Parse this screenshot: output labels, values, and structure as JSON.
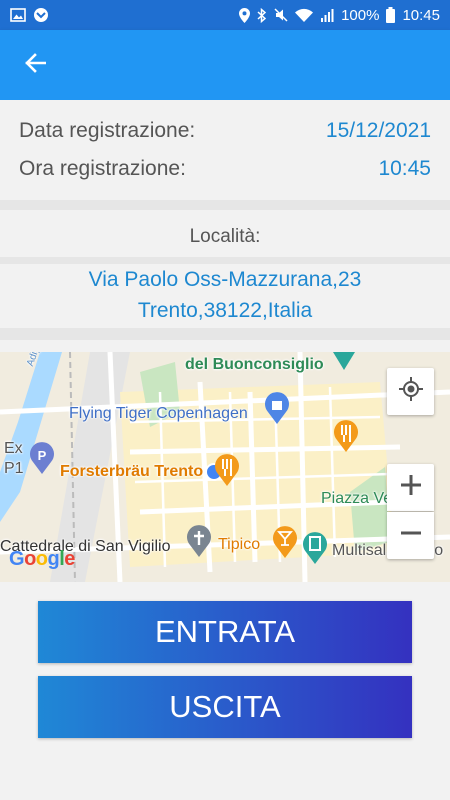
{
  "status_bar": {
    "battery_percent": "100%",
    "time": "10:45",
    "icons": [
      "image-icon",
      "app-icon",
      "location-icon",
      "bluetooth-icon",
      "mute-icon",
      "wifi-icon",
      "signal-icon",
      "battery-icon"
    ]
  },
  "app_bar": {
    "back_icon": "arrow-back-icon"
  },
  "registration": {
    "date_label": "Data registrazione:",
    "date_value": "15/12/2021",
    "time_label": "Ora registrazione:",
    "time_value": "10:45"
  },
  "location": {
    "title": "Località:",
    "address_line1": "Via Paolo Oss-Mazzurana,23",
    "address_line2": "Trento,38122,Italia"
  },
  "map": {
    "labels": {
      "buonconsiglio": "del Buonconsiglio",
      "flying_tiger": "Flying Tiger Copenhagen",
      "ex": "Ex",
      "p1": "P1",
      "forsterbrau": "Forsterbräu Trento",
      "piazza_venezia": "Piazza Venezia",
      "cattedrale": "Cattedrale di San Vigilio",
      "tipico": "Tipico",
      "multisala": "Multisala G. Mo",
      "adige": "Adige"
    },
    "logo": "Google"
  },
  "buttons": {
    "entrata": "ENTRATA",
    "uscita": "USCITA"
  },
  "colors": {
    "app_bar": "#2196f3",
    "status_bar": "#1f6fd1",
    "accent_text": "#1e88d0",
    "button_gradient_start": "#1f88d6",
    "button_gradient_end": "#3431c0"
  }
}
